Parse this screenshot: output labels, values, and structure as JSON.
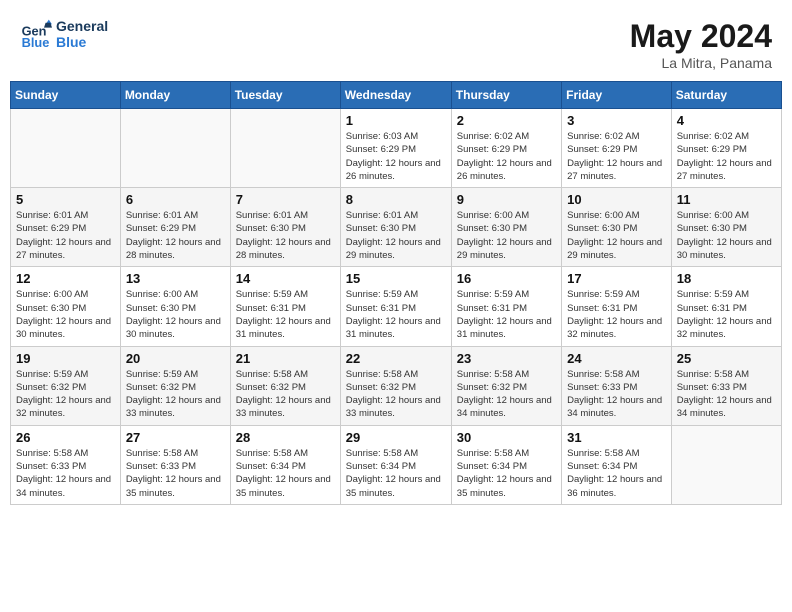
{
  "header": {
    "logo_line1": "General",
    "logo_line2": "Blue",
    "month_title": "May 2024",
    "location": "La Mitra, Panama"
  },
  "weekdays": [
    "Sunday",
    "Monday",
    "Tuesday",
    "Wednesday",
    "Thursday",
    "Friday",
    "Saturday"
  ],
  "weeks": [
    [
      {
        "day": "",
        "sunrise": "",
        "sunset": "",
        "daylight": ""
      },
      {
        "day": "",
        "sunrise": "",
        "sunset": "",
        "daylight": ""
      },
      {
        "day": "",
        "sunrise": "",
        "sunset": "",
        "daylight": ""
      },
      {
        "day": "1",
        "sunrise": "Sunrise: 6:03 AM",
        "sunset": "Sunset: 6:29 PM",
        "daylight": "Daylight: 12 hours and 26 minutes."
      },
      {
        "day": "2",
        "sunrise": "Sunrise: 6:02 AM",
        "sunset": "Sunset: 6:29 PM",
        "daylight": "Daylight: 12 hours and 26 minutes."
      },
      {
        "day": "3",
        "sunrise": "Sunrise: 6:02 AM",
        "sunset": "Sunset: 6:29 PM",
        "daylight": "Daylight: 12 hours and 27 minutes."
      },
      {
        "day": "4",
        "sunrise": "Sunrise: 6:02 AM",
        "sunset": "Sunset: 6:29 PM",
        "daylight": "Daylight: 12 hours and 27 minutes."
      }
    ],
    [
      {
        "day": "5",
        "sunrise": "Sunrise: 6:01 AM",
        "sunset": "Sunset: 6:29 PM",
        "daylight": "Daylight: 12 hours and 27 minutes."
      },
      {
        "day": "6",
        "sunrise": "Sunrise: 6:01 AM",
        "sunset": "Sunset: 6:29 PM",
        "daylight": "Daylight: 12 hours and 28 minutes."
      },
      {
        "day": "7",
        "sunrise": "Sunrise: 6:01 AM",
        "sunset": "Sunset: 6:30 PM",
        "daylight": "Daylight: 12 hours and 28 minutes."
      },
      {
        "day": "8",
        "sunrise": "Sunrise: 6:01 AM",
        "sunset": "Sunset: 6:30 PM",
        "daylight": "Daylight: 12 hours and 29 minutes."
      },
      {
        "day": "9",
        "sunrise": "Sunrise: 6:00 AM",
        "sunset": "Sunset: 6:30 PM",
        "daylight": "Daylight: 12 hours and 29 minutes."
      },
      {
        "day": "10",
        "sunrise": "Sunrise: 6:00 AM",
        "sunset": "Sunset: 6:30 PM",
        "daylight": "Daylight: 12 hours and 29 minutes."
      },
      {
        "day": "11",
        "sunrise": "Sunrise: 6:00 AM",
        "sunset": "Sunset: 6:30 PM",
        "daylight": "Daylight: 12 hours and 30 minutes."
      }
    ],
    [
      {
        "day": "12",
        "sunrise": "Sunrise: 6:00 AM",
        "sunset": "Sunset: 6:30 PM",
        "daylight": "Daylight: 12 hours and 30 minutes."
      },
      {
        "day": "13",
        "sunrise": "Sunrise: 6:00 AM",
        "sunset": "Sunset: 6:30 PM",
        "daylight": "Daylight: 12 hours and 30 minutes."
      },
      {
        "day": "14",
        "sunrise": "Sunrise: 5:59 AM",
        "sunset": "Sunset: 6:31 PM",
        "daylight": "Daylight: 12 hours and 31 minutes."
      },
      {
        "day": "15",
        "sunrise": "Sunrise: 5:59 AM",
        "sunset": "Sunset: 6:31 PM",
        "daylight": "Daylight: 12 hours and 31 minutes."
      },
      {
        "day": "16",
        "sunrise": "Sunrise: 5:59 AM",
        "sunset": "Sunset: 6:31 PM",
        "daylight": "Daylight: 12 hours and 31 minutes."
      },
      {
        "day": "17",
        "sunrise": "Sunrise: 5:59 AM",
        "sunset": "Sunset: 6:31 PM",
        "daylight": "Daylight: 12 hours and 32 minutes."
      },
      {
        "day": "18",
        "sunrise": "Sunrise: 5:59 AM",
        "sunset": "Sunset: 6:31 PM",
        "daylight": "Daylight: 12 hours and 32 minutes."
      }
    ],
    [
      {
        "day": "19",
        "sunrise": "Sunrise: 5:59 AM",
        "sunset": "Sunset: 6:32 PM",
        "daylight": "Daylight: 12 hours and 32 minutes."
      },
      {
        "day": "20",
        "sunrise": "Sunrise: 5:59 AM",
        "sunset": "Sunset: 6:32 PM",
        "daylight": "Daylight: 12 hours and 33 minutes."
      },
      {
        "day": "21",
        "sunrise": "Sunrise: 5:58 AM",
        "sunset": "Sunset: 6:32 PM",
        "daylight": "Daylight: 12 hours and 33 minutes."
      },
      {
        "day": "22",
        "sunrise": "Sunrise: 5:58 AM",
        "sunset": "Sunset: 6:32 PM",
        "daylight": "Daylight: 12 hours and 33 minutes."
      },
      {
        "day": "23",
        "sunrise": "Sunrise: 5:58 AM",
        "sunset": "Sunset: 6:32 PM",
        "daylight": "Daylight: 12 hours and 34 minutes."
      },
      {
        "day": "24",
        "sunrise": "Sunrise: 5:58 AM",
        "sunset": "Sunset: 6:33 PM",
        "daylight": "Daylight: 12 hours and 34 minutes."
      },
      {
        "day": "25",
        "sunrise": "Sunrise: 5:58 AM",
        "sunset": "Sunset: 6:33 PM",
        "daylight": "Daylight: 12 hours and 34 minutes."
      }
    ],
    [
      {
        "day": "26",
        "sunrise": "Sunrise: 5:58 AM",
        "sunset": "Sunset: 6:33 PM",
        "daylight": "Daylight: 12 hours and 34 minutes."
      },
      {
        "day": "27",
        "sunrise": "Sunrise: 5:58 AM",
        "sunset": "Sunset: 6:33 PM",
        "daylight": "Daylight: 12 hours and 35 minutes."
      },
      {
        "day": "28",
        "sunrise": "Sunrise: 5:58 AM",
        "sunset": "Sunset: 6:34 PM",
        "daylight": "Daylight: 12 hours and 35 minutes."
      },
      {
        "day": "29",
        "sunrise": "Sunrise: 5:58 AM",
        "sunset": "Sunset: 6:34 PM",
        "daylight": "Daylight: 12 hours and 35 minutes."
      },
      {
        "day": "30",
        "sunrise": "Sunrise: 5:58 AM",
        "sunset": "Sunset: 6:34 PM",
        "daylight": "Daylight: 12 hours and 35 minutes."
      },
      {
        "day": "31",
        "sunrise": "Sunrise: 5:58 AM",
        "sunset": "Sunset: 6:34 PM",
        "daylight": "Daylight: 12 hours and 36 minutes."
      },
      {
        "day": "",
        "sunrise": "",
        "sunset": "",
        "daylight": ""
      }
    ]
  ]
}
